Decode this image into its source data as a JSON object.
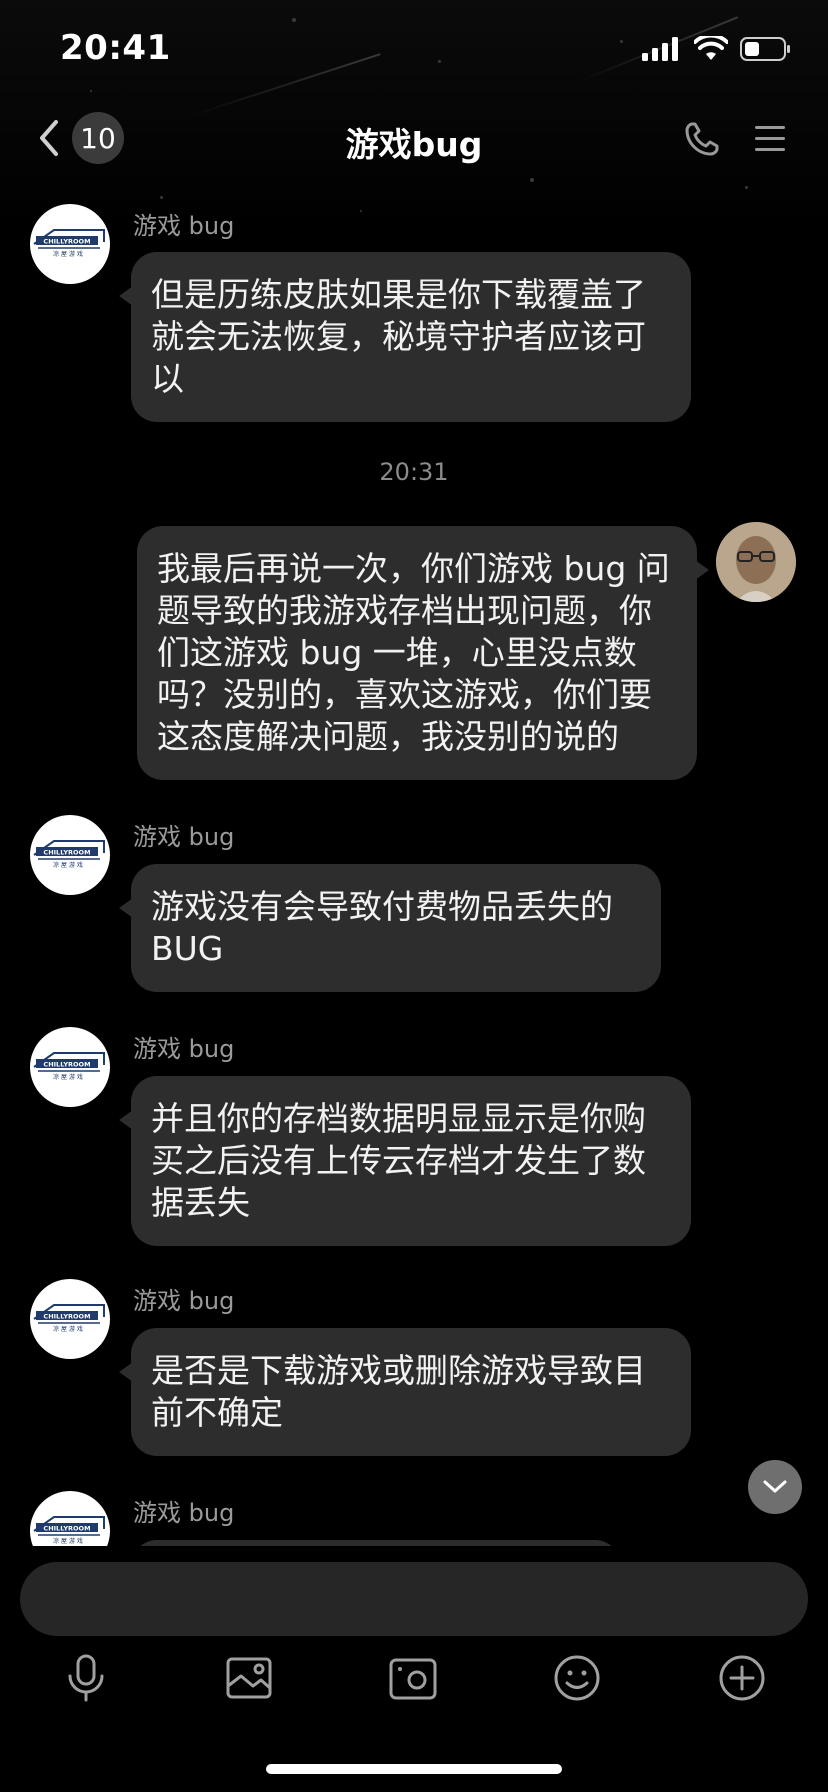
{
  "status_bar": {
    "time": "20:41"
  },
  "nav": {
    "unread_count": "10",
    "title": "游戏bug"
  },
  "messages": [
    {
      "sender": "游戏 bug",
      "text": "但是历练皮肤如果是你下载覆盖了\n就会无法恢复，秘境守护者应该可\n以"
    },
    {
      "timestamp": "20:31"
    },
    {
      "sender": "",
      "text": "我最后再说一次，你们游戏 bug 问\n题导致的我游戏存档出现问题，你\n们这游戏 bug 一堆，心里没点数\n吗？没别的，喜欢这游戏，你们要\n这态度解决问题，我没别的说的"
    },
    {
      "sender": "游戏 bug",
      "text": "游戏没有会导致付费物品丢失的\nBUG"
    },
    {
      "sender": "游戏 bug",
      "text": "并且你的存档数据明显显示是你购\n买之后没有上传云存档才发生了数\n据丢失"
    },
    {
      "sender": "游戏 bug",
      "text": "是否是下载游戏或删除游戏导致目\n前不确定"
    },
    {
      "sender": "游戏 bug",
      "text": ""
    }
  ],
  "avatar_logo": {
    "text_top": "CHILLYROOM",
    "text_bottom": "凉 屋 游 戏"
  },
  "input": {
    "value": ""
  },
  "colors": {
    "bubble": "#2d2d2d",
    "background": "#000000",
    "accent_logo": "#1f3a6b"
  }
}
